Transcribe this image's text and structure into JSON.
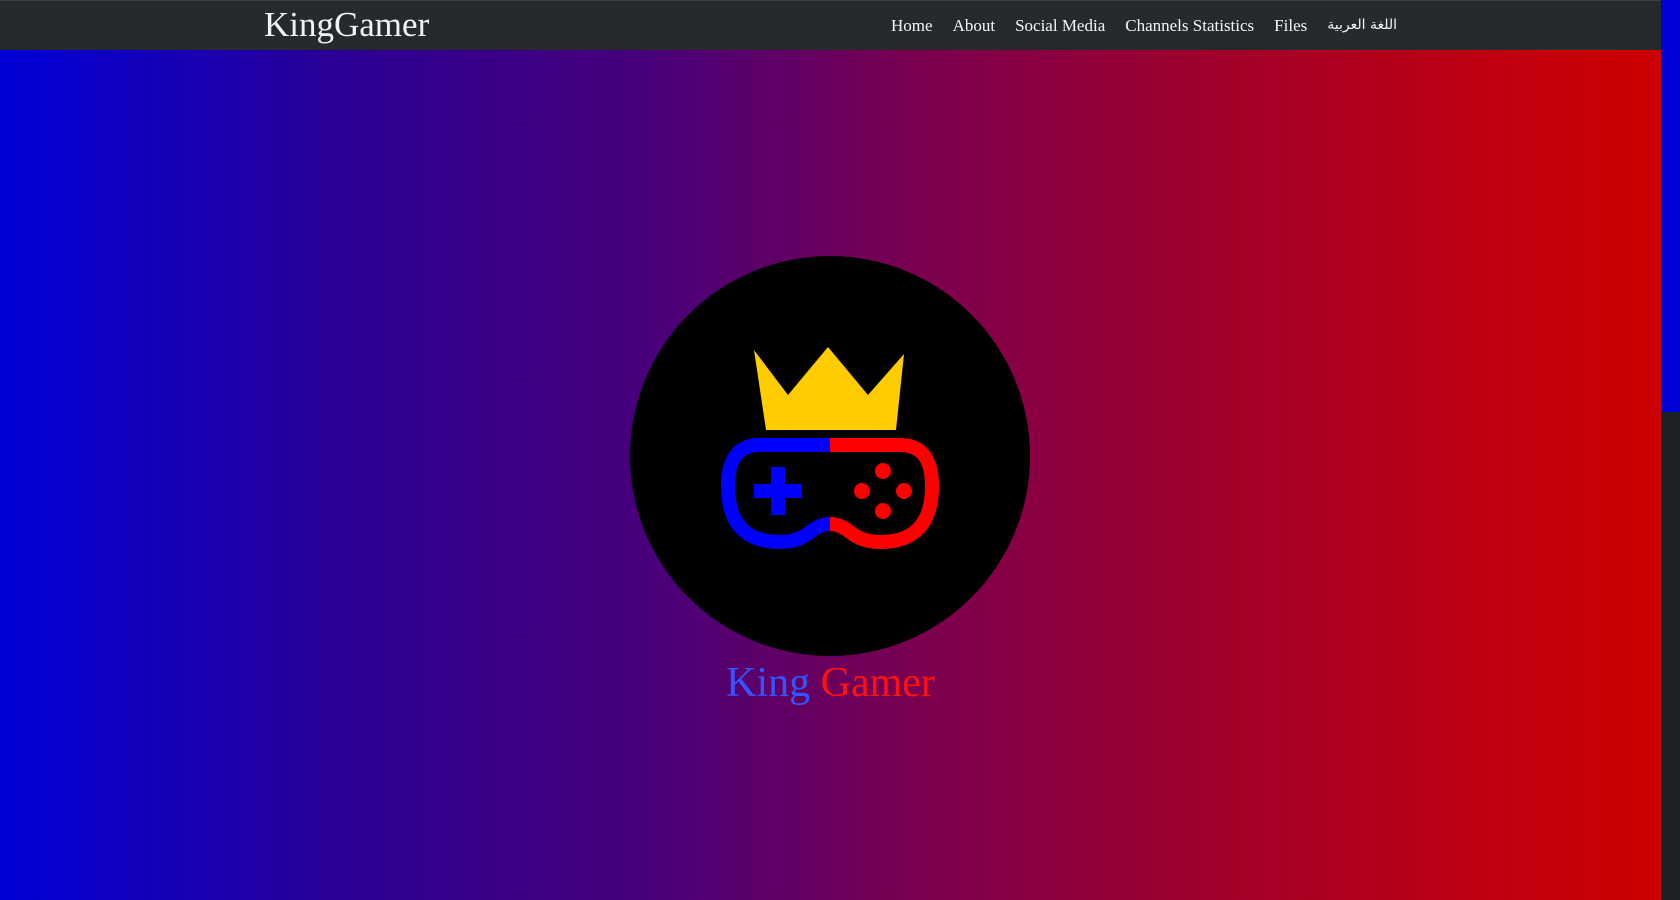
{
  "navbar": {
    "brand": "KingGamer",
    "links": [
      {
        "label": "Home"
      },
      {
        "label": "About"
      },
      {
        "label": "Social Media"
      },
      {
        "label": "Channels Statistics"
      },
      {
        "label": "Files"
      },
      {
        "label": "اللغة العربية"
      }
    ]
  },
  "hero": {
    "logo_icon": "crown-gamepad-icon",
    "title_part1": "King",
    "title_part2": "Gamer"
  },
  "colors": {
    "navbar_bg": "#262a2d",
    "gradient_start": "#0000d8",
    "gradient_end": "#cc0000",
    "crown": "#ffcc00",
    "controller_left": "#0000ff",
    "controller_right": "#ff0000",
    "title_king": "#3355ff",
    "title_gamer": "#ff1111"
  }
}
